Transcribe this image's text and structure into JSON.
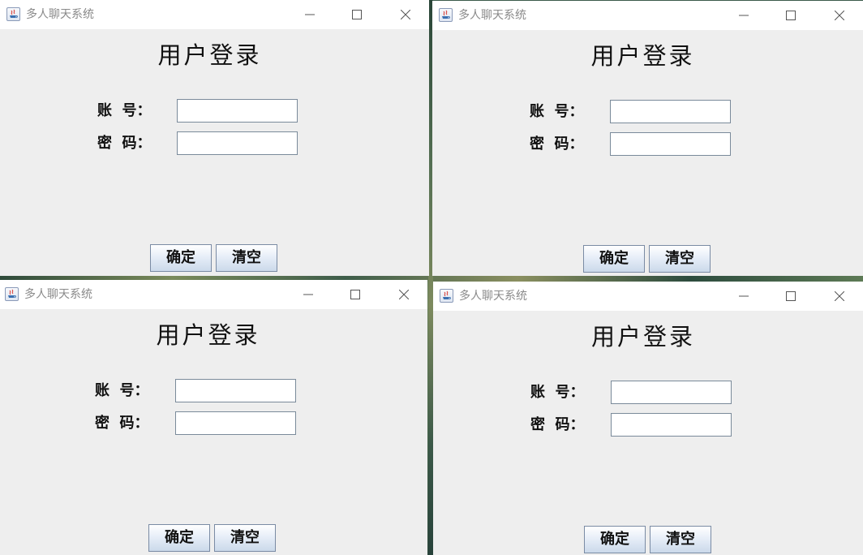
{
  "windows": [
    {
      "title": "多人聊天系统",
      "heading": "用户登录",
      "account_label": "账  号：",
      "account_value": "",
      "password_label": "密  码：",
      "password_value": "",
      "confirm_label": "确定",
      "clear_label": "清空",
      "icons": {
        "app": "java-app-icon",
        "minimize": "minimize-icon",
        "maximize": "maximize-icon",
        "close": "close-icon"
      }
    },
    {
      "title": "多人聊天系统",
      "heading": "用户登录",
      "account_label": "账  号：",
      "account_value": "",
      "password_label": "密  码：",
      "password_value": "",
      "confirm_label": "确定",
      "clear_label": "清空",
      "icons": {
        "app": "java-app-icon",
        "minimize": "minimize-icon",
        "maximize": "maximize-icon",
        "close": "close-icon"
      }
    },
    {
      "title": "多人聊天系统",
      "heading": "用户登录",
      "account_label": "账  号：",
      "account_value": "",
      "password_label": "密  码：",
      "password_value": "",
      "confirm_label": "确定",
      "clear_label": "清空",
      "icons": {
        "app": "java-app-icon",
        "minimize": "minimize-icon",
        "maximize": "maximize-icon",
        "close": "close-icon"
      }
    },
    {
      "title": "多人聊天系统",
      "heading": "用户登录",
      "account_label": "账  号：",
      "account_value": "",
      "password_label": "密  码：",
      "password_value": "",
      "confirm_label": "确定",
      "clear_label": "清空",
      "icons": {
        "app": "java-app-icon",
        "minimize": "minimize-icon",
        "maximize": "maximize-icon",
        "close": "close-icon"
      }
    }
  ],
  "colors": {
    "window_bg": "#eeeeee",
    "titlebar_bg": "#ffffff",
    "title_text": "#8a8a8a",
    "button_border": "#7a8ba4"
  }
}
